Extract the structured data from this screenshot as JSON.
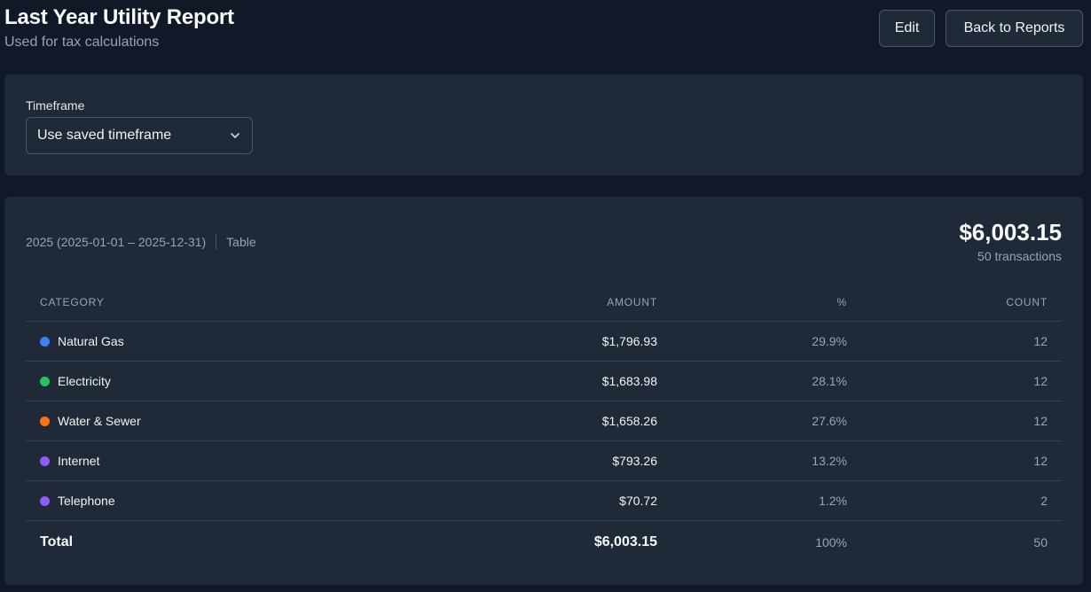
{
  "header": {
    "title": "Last Year Utility Report",
    "subtitle": "Used for tax calculations",
    "edit_label": "Edit",
    "back_label": "Back to Reports"
  },
  "timeframe": {
    "label": "Timeframe",
    "selected": "Use saved timeframe"
  },
  "report": {
    "period": "2025 (2025-01-01 – 2025-12-31)",
    "view": "Table",
    "total": "$6,003.15",
    "transactions": "50 transactions",
    "columns": {
      "category": "CATEGORY",
      "amount": "AMOUNT",
      "percent": "%",
      "count": "COUNT"
    },
    "rows": [
      {
        "category": "Natural Gas",
        "amount": "$1,796.93",
        "percent": "29.9%",
        "count": "12",
        "color": "#3b82f6"
      },
      {
        "category": "Electricity",
        "amount": "$1,683.98",
        "percent": "28.1%",
        "count": "12",
        "color": "#22c55e"
      },
      {
        "category": "Water & Sewer",
        "amount": "$1,658.26",
        "percent": "27.6%",
        "count": "12",
        "color": "#f97316"
      },
      {
        "category": "Internet",
        "amount": "$793.26",
        "percent": "13.2%",
        "count": "12",
        "color": "#8b5cf6"
      },
      {
        "category": "Telephone",
        "amount": "$70.72",
        "percent": "1.2%",
        "count": "2",
        "color": "#8b5cf6"
      }
    ],
    "totals": {
      "label": "Total",
      "amount": "$6,003.15",
      "percent": "100%",
      "count": "50"
    }
  }
}
